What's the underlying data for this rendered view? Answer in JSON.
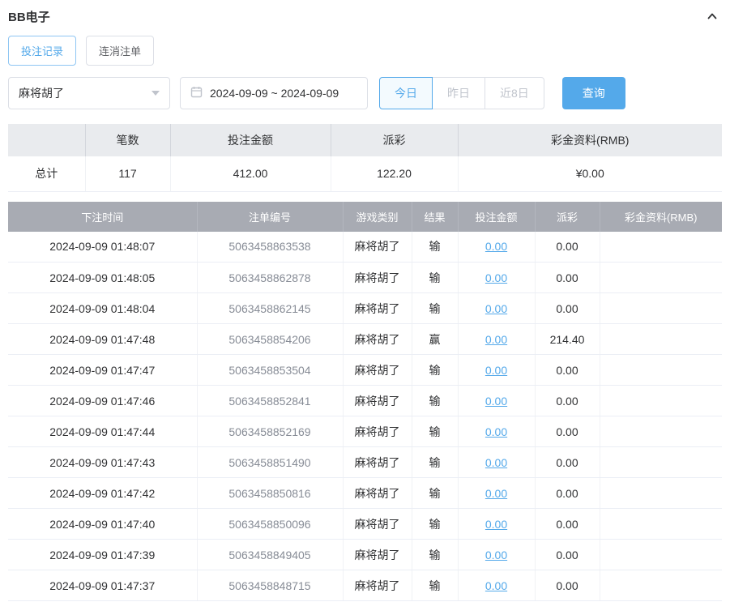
{
  "header": {
    "title": "BB电子"
  },
  "tabs": [
    {
      "label": "投注记录",
      "active": true
    },
    {
      "label": "连消注单",
      "active": false
    }
  ],
  "filters": {
    "game_select": {
      "value": "麻将胡了"
    },
    "date_range": {
      "value": "2024-09-09 ~ 2024-09-09"
    },
    "quick_buttons": [
      {
        "label": "今日",
        "active": true
      },
      {
        "label": "昨日",
        "active": false
      },
      {
        "label": "近8日",
        "active": false
      }
    ],
    "search_label": "查询"
  },
  "summary": {
    "headers": [
      "",
      "笔数",
      "投注金额",
      "派彩",
      "彩金资料(RMB)"
    ],
    "row_label": "总计",
    "count": "117",
    "bet_total": "412.00",
    "payout_total": "122.20",
    "jackpot_total": "¥0.00"
  },
  "table": {
    "headers": [
      "下注时间",
      "注单编号",
      "游戏类别",
      "结果",
      "投注金额",
      "派彩",
      "彩金资料(RMB)"
    ],
    "rows": [
      {
        "time": "2024-09-09 01:48:07",
        "order_no": "5063458863538",
        "game": "麻将胡了",
        "result": "输",
        "bet": "0.00",
        "payout": "0.00",
        "jackpot": ""
      },
      {
        "time": "2024-09-09 01:48:05",
        "order_no": "5063458862878",
        "game": "麻将胡了",
        "result": "输",
        "bet": "0.00",
        "payout": "0.00",
        "jackpot": ""
      },
      {
        "time": "2024-09-09 01:48:04",
        "order_no": "5063458862145",
        "game": "麻将胡了",
        "result": "输",
        "bet": "0.00",
        "payout": "0.00",
        "jackpot": ""
      },
      {
        "time": "2024-09-09 01:47:48",
        "order_no": "5063458854206",
        "game": "麻将胡了",
        "result": "赢",
        "bet": "0.00",
        "payout": "214.40",
        "jackpot": ""
      },
      {
        "time": "2024-09-09 01:47:47",
        "order_no": "5063458853504",
        "game": "麻将胡了",
        "result": "输",
        "bet": "0.00",
        "payout": "0.00",
        "jackpot": ""
      },
      {
        "time": "2024-09-09 01:47:46",
        "order_no": "5063458852841",
        "game": "麻将胡了",
        "result": "输",
        "bet": "0.00",
        "payout": "0.00",
        "jackpot": ""
      },
      {
        "time": "2024-09-09 01:47:44",
        "order_no": "5063458852169",
        "game": "麻将胡了",
        "result": "输",
        "bet": "0.00",
        "payout": "0.00",
        "jackpot": ""
      },
      {
        "time": "2024-09-09 01:47:43",
        "order_no": "5063458851490",
        "game": "麻将胡了",
        "result": "输",
        "bet": "0.00",
        "payout": "0.00",
        "jackpot": ""
      },
      {
        "time": "2024-09-09 01:47:42",
        "order_no": "5063458850816",
        "game": "麻将胡了",
        "result": "输",
        "bet": "0.00",
        "payout": "0.00",
        "jackpot": ""
      },
      {
        "time": "2024-09-09 01:47:40",
        "order_no": "5063458850096",
        "game": "麻将胡了",
        "result": "输",
        "bet": "0.00",
        "payout": "0.00",
        "jackpot": ""
      },
      {
        "time": "2024-09-09 01:47:39",
        "order_no": "5063458849405",
        "game": "麻将胡了",
        "result": "输",
        "bet": "0.00",
        "payout": "0.00",
        "jackpot": ""
      },
      {
        "time": "2024-09-09 01:47:37",
        "order_no": "5063458848715",
        "game": "麻将胡了",
        "result": "输",
        "bet": "0.00",
        "payout": "0.00",
        "jackpot": ""
      }
    ]
  },
  "colors": {
    "accent": "#54a9ea",
    "link": "#54a9ea",
    "table_header_bg": "#a8abb3",
    "summary_header_bg": "#e9ebee"
  }
}
